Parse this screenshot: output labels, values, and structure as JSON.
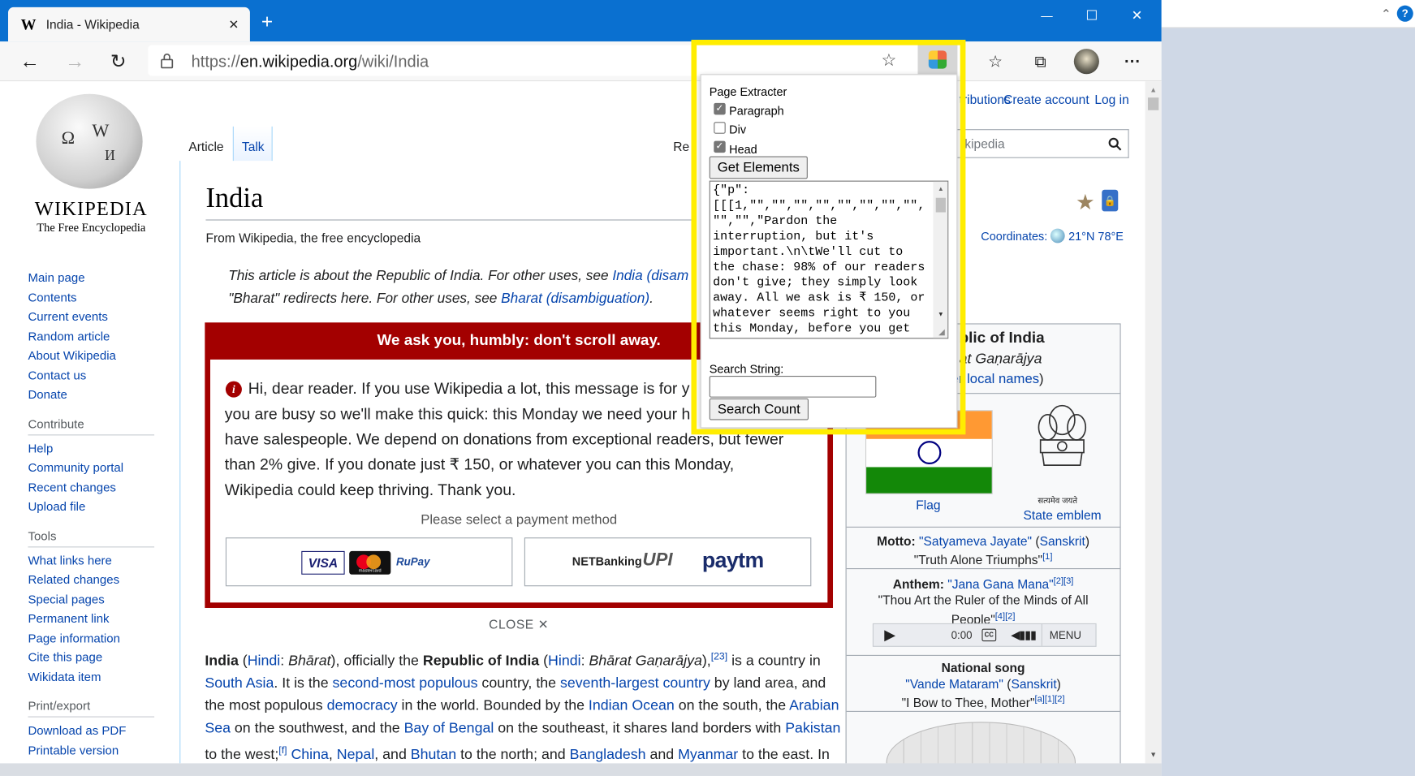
{
  "browser": {
    "tab_title": "India - Wikipedia",
    "new_tab": "+",
    "url_scheme": "https://",
    "url_host": "en.wikipedia.org",
    "url_path": "/wiki/India",
    "window_min": "—",
    "window_max": "☐",
    "window_close": "✕",
    "menu": "···"
  },
  "wiki": {
    "logo_word": "WIKIPEDIA",
    "logo_tagline": "The Free Encyclopedia",
    "tab_article": "Article",
    "tab_talk": "Talk",
    "tab_read": "Re",
    "user_contrib": "tributions",
    "create_account": "Create account",
    "login": "Log in",
    "search_placeholder": "kipedia",
    "title": "India",
    "from": "From Wikipedia, the free encyclopedia",
    "coordinates_label": "Coordinates:",
    "coordinates_value": "21°N 78°E",
    "hatnote1_pre": "This article is about the Republic of India. For other uses, see ",
    "hatnote1_link": "India (disam",
    "hatnote2_pre": "\"Bharat\" redirects here. For other uses, see ",
    "hatnote2_link": "Bharat (disambiguation)",
    "hatnote2_post": ".",
    "nav_main": [
      "Main page",
      "Contents",
      "Current events",
      "Random article",
      "About Wikipedia",
      "Contact us",
      "Donate"
    ],
    "contribute_heading": "Contribute",
    "nav_contribute": [
      "Help",
      "Community portal",
      "Recent changes",
      "Upload file"
    ],
    "tools_heading": "Tools",
    "nav_tools": [
      "What links here",
      "Related changes",
      "Special pages",
      "Permanent link",
      "Page information",
      "Cite this page",
      "Wikidata item"
    ],
    "print_heading": "Print/export",
    "nav_print": [
      "Download as PDF",
      "Printable version"
    ]
  },
  "banner": {
    "heading": "We ask you, humbly: don't scroll away.",
    "line1": "Hi, dear reader. If you use Wikipedia a lot, this message is for y",
    "line2": "you are busy so we'll make this quick: this Monday we need your h",
    "line3": "have salespeople. We depend on donations from exceptional readers, but fewer",
    "line4": "than 2% give. If you donate just ₹ 150, or whatever you can this Monday,",
    "line5": "Wikipedia could keep thriving. Thank you.",
    "payment_prompt": "Please select a payment method",
    "card_visa": "VISA",
    "card_mastercard": "mastercard",
    "card_rupay": "RuPay",
    "netbanking": "NETBanking",
    "upi": "UPI",
    "paytm": "paytm",
    "close": "CLOSE"
  },
  "infobox": {
    "title": "blic of India",
    "native": "at Gaṇarājya",
    "local_names": "er local names",
    "flag_caption": "Flag",
    "emblem_motto_text": "सत्यमेव जयते",
    "emblem_caption": "State emblem",
    "motto_label": "Motto:",
    "motto_value": "\"Satyameva Jayate\"",
    "motto_lang": "Sanskrit",
    "motto_translation": "\"Truth Alone Triumphs\"",
    "motto_ref": "[1]",
    "anthem_label": "Anthem:",
    "anthem_value": "\"Jana Gana Mana\"",
    "anthem_refs": "[2][3]",
    "anthem_translation_1": "\"Thou Art the Ruler of the Minds of All",
    "anthem_translation_2": "People\"",
    "anthem_refs2": "[4][2]",
    "player_time": "0:00",
    "player_menu": "MENU",
    "song_label": "National song",
    "song_value": "\"Vande Mataram\"",
    "song_lang": "Sanskrit",
    "song_translation": "\"I Bow to Thee, Mother\"",
    "song_refs": "[a][1][2]"
  },
  "article": {
    "p1": "India",
    "p1_hindi": "Hindi",
    "p1_bharat": "Bhārat",
    "p1_mid": "), officially the ",
    "p1_republic": "Republic of India",
    "p1_hindi2": "Hindi",
    "p1_ganarajya": "Bhārat Gaṇarājya",
    "p1_ref": "[23]",
    "p1_tail": " is a country in",
    "l2_a": "South Asia",
    "l2_b": ". It is the ",
    "l2_c": "second-most populous",
    "l2_d": " country, the ",
    "l2_e": "seventh-largest country",
    "l2_f": " by land area, and",
    "l3_a": "the most populous ",
    "l3_b": "democracy",
    "l3_c": " in the world. Bounded by the ",
    "l3_d": "Indian Ocean",
    "l3_e": " on the south, the ",
    "l3_f": "Arabian",
    "l4_a": "Sea",
    "l4_b": " on the southwest, and the ",
    "l4_c": "Bay of Bengal",
    "l4_d": " on the southeast, it shares land borders with ",
    "l4_e": "Pakistan",
    "l5_a": "to the west;",
    "l5_ref": "[f]",
    "l5_b": "China",
    "l5_c": "Nepal",
    "l5_d": "Bhutan",
    "l5_e": " to the north; and ",
    "l5_f": "Bangladesh",
    "l5_g": "Myanmar",
    "l5_h": " to the east. In"
  },
  "extension": {
    "title": "Page Extracter",
    "opt_paragraph": "Paragraph",
    "opt_div": "Div",
    "opt_head": "Head",
    "paragraph_checked": true,
    "div_checked": false,
    "head_checked": true,
    "get_button": "Get Elements",
    "output": "{\"p\":\n[[[1,\"\",\"\",\"\",\"\",\"\",\"\",\"\",\"\",\n\"\",\"\",\"Pardon the\ninterruption, but it's\nimportant.\\n\\tWe'll cut to\nthe chase: 98% of our readers\ndon't give; they simply look\naway. All we ask is ₹ 150, or\nwhatever seems right to you\nthis Monday, before you get",
    "search_label": "Search String:",
    "search_value": "",
    "count_button": "Search Count"
  },
  "colors": {
    "titlebar": "#0a70d0",
    "highlight": "#ffed00",
    "banner_red": "#a30000",
    "link": "#0645ad"
  }
}
